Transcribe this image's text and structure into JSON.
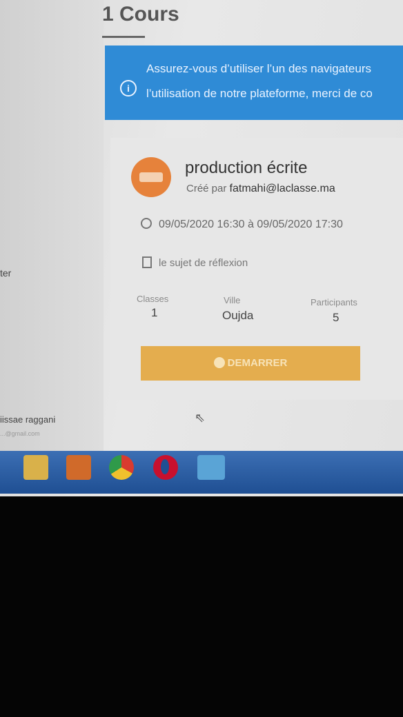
{
  "page": {
    "title": "1 Cours"
  },
  "banner": {
    "line1": "Assurez-vous d’utiliser l’un des navigateurs",
    "line2": "l’utilisation de notre plateforme, merci de co",
    "icon": "info-icon"
  },
  "sidebar": {
    "partial_text": "ter",
    "user_name": "iissae raggani",
    "user_email": "...@gmail.com"
  },
  "course": {
    "title": "production écrite",
    "created_label": "Créé par",
    "created_by": "fatmahi@laclasse.ma",
    "dates": "09/05/2020 16:30 à 09/05/2020 17:30",
    "document": "le sujet de réflexion",
    "stats": {
      "classes_label": "Classes",
      "classes_value": "1",
      "ville_label": "Ville",
      "ville_value": "Oujda",
      "participants_label": "Participants",
      "participants_value": "5"
    },
    "start_button": "DEMARRER"
  },
  "taskbar": {
    "apps": [
      "folder-icon",
      "media-player-icon",
      "chrome-icon",
      "opera-icon",
      "active-window-icon"
    ]
  },
  "colors": {
    "banner_bg": "#2f8bd6",
    "start_button_bg": "#e4ad4e",
    "avatar_bg": "#e6823b",
    "taskbar_bg": "#1f4f93"
  }
}
